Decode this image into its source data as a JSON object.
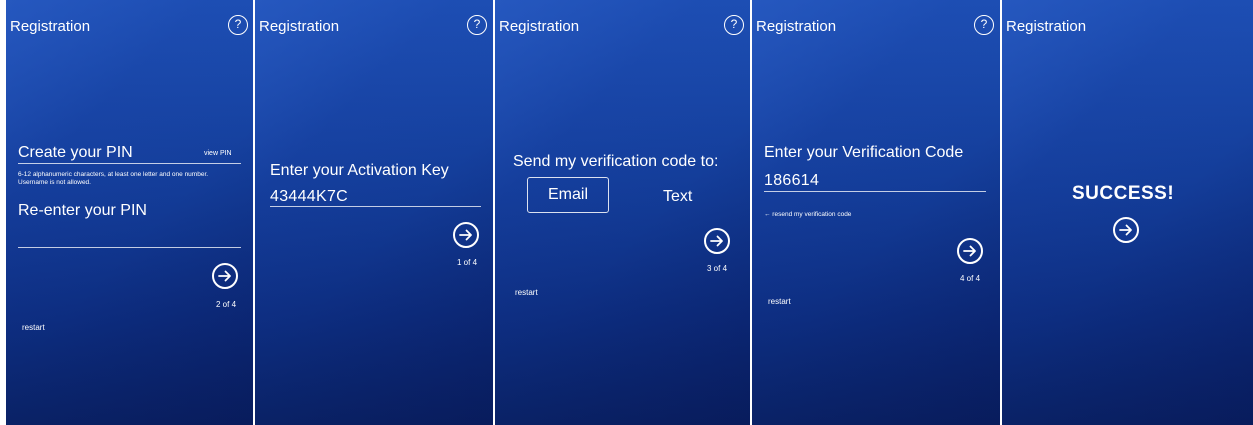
{
  "common": {
    "title": "Registration",
    "help_glyph": "?"
  },
  "panel1": {
    "heading": "Create your PIN",
    "view_pin": "view PIN",
    "hint": "6-12 alphanumeric characters, at least one letter and one number. Username is not allowed.",
    "reenter": "Re-enter your PIN",
    "step": "2 of 4",
    "restart": "restart"
  },
  "panel2": {
    "heading": "Enter your Activation Key",
    "value": "43444K7C",
    "step": "1 of 4"
  },
  "panel3": {
    "heading": "Send my verification code to:",
    "option_email": "Email",
    "option_text": "Text",
    "step": "3 of 4",
    "restart": "restart"
  },
  "panel4": {
    "heading": "Enter your Verification Code",
    "value": "186614",
    "resend": "← resend my verification code",
    "step": "4 of 4",
    "restart": "restart"
  },
  "panel5": {
    "message": "SUCCESS!"
  },
  "icons": {
    "help": "help-circle-icon",
    "next": "arrow-right-circle-icon"
  }
}
